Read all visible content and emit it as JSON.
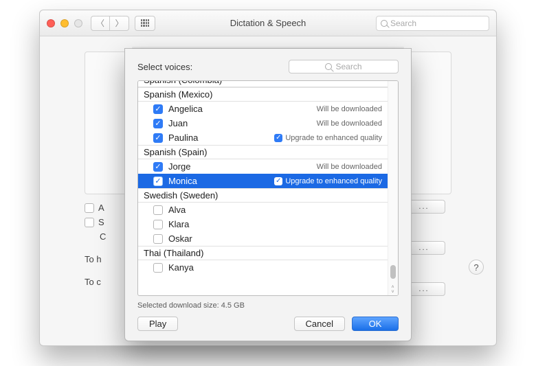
{
  "parent": {
    "title": "Dictation & Speech",
    "search_placeholder": "Search",
    "bg_check_a_prefix": "A",
    "bg_check_s_prefix": "S",
    "bg_letter_c": "C",
    "hint1_prefix": "To h",
    "hint2_prefix": "To c",
    "side_button_dots": "..."
  },
  "sheet": {
    "title": "Select voices:",
    "search_placeholder": "Search",
    "download_label": "Selected download size: 4.5 GB",
    "play": "Play",
    "cancel": "Cancel",
    "ok": "OK",
    "groups": [
      {
        "label": "Spanish (Colombia)",
        "cut": true,
        "voices": []
      },
      {
        "label": "Spanish (Mexico)",
        "voices": [
          {
            "name": "Angelica",
            "checked": true,
            "note": "Will be downloaded"
          },
          {
            "name": "Juan",
            "checked": true,
            "note": "Will be downloaded"
          },
          {
            "name": "Paulina",
            "checked": true,
            "note": "Upgrade to enhanced quality",
            "note_has_check": true
          }
        ]
      },
      {
        "label": "Spanish (Spain)",
        "voices": [
          {
            "name": "Jorge",
            "checked": true,
            "note": "Will be downloaded"
          },
          {
            "name": "Monica",
            "checked": true,
            "selected": true,
            "note": "Upgrade to enhanced quality",
            "note_has_check": true
          }
        ]
      },
      {
        "label": "Swedish (Sweden)",
        "voices": [
          {
            "name": "Alva",
            "checked": false
          },
          {
            "name": "Klara",
            "checked": false
          },
          {
            "name": "Oskar",
            "checked": false
          }
        ]
      },
      {
        "label": "Thai (Thailand)",
        "voices": [
          {
            "name": "Kanya",
            "checked": false
          }
        ]
      }
    ]
  }
}
